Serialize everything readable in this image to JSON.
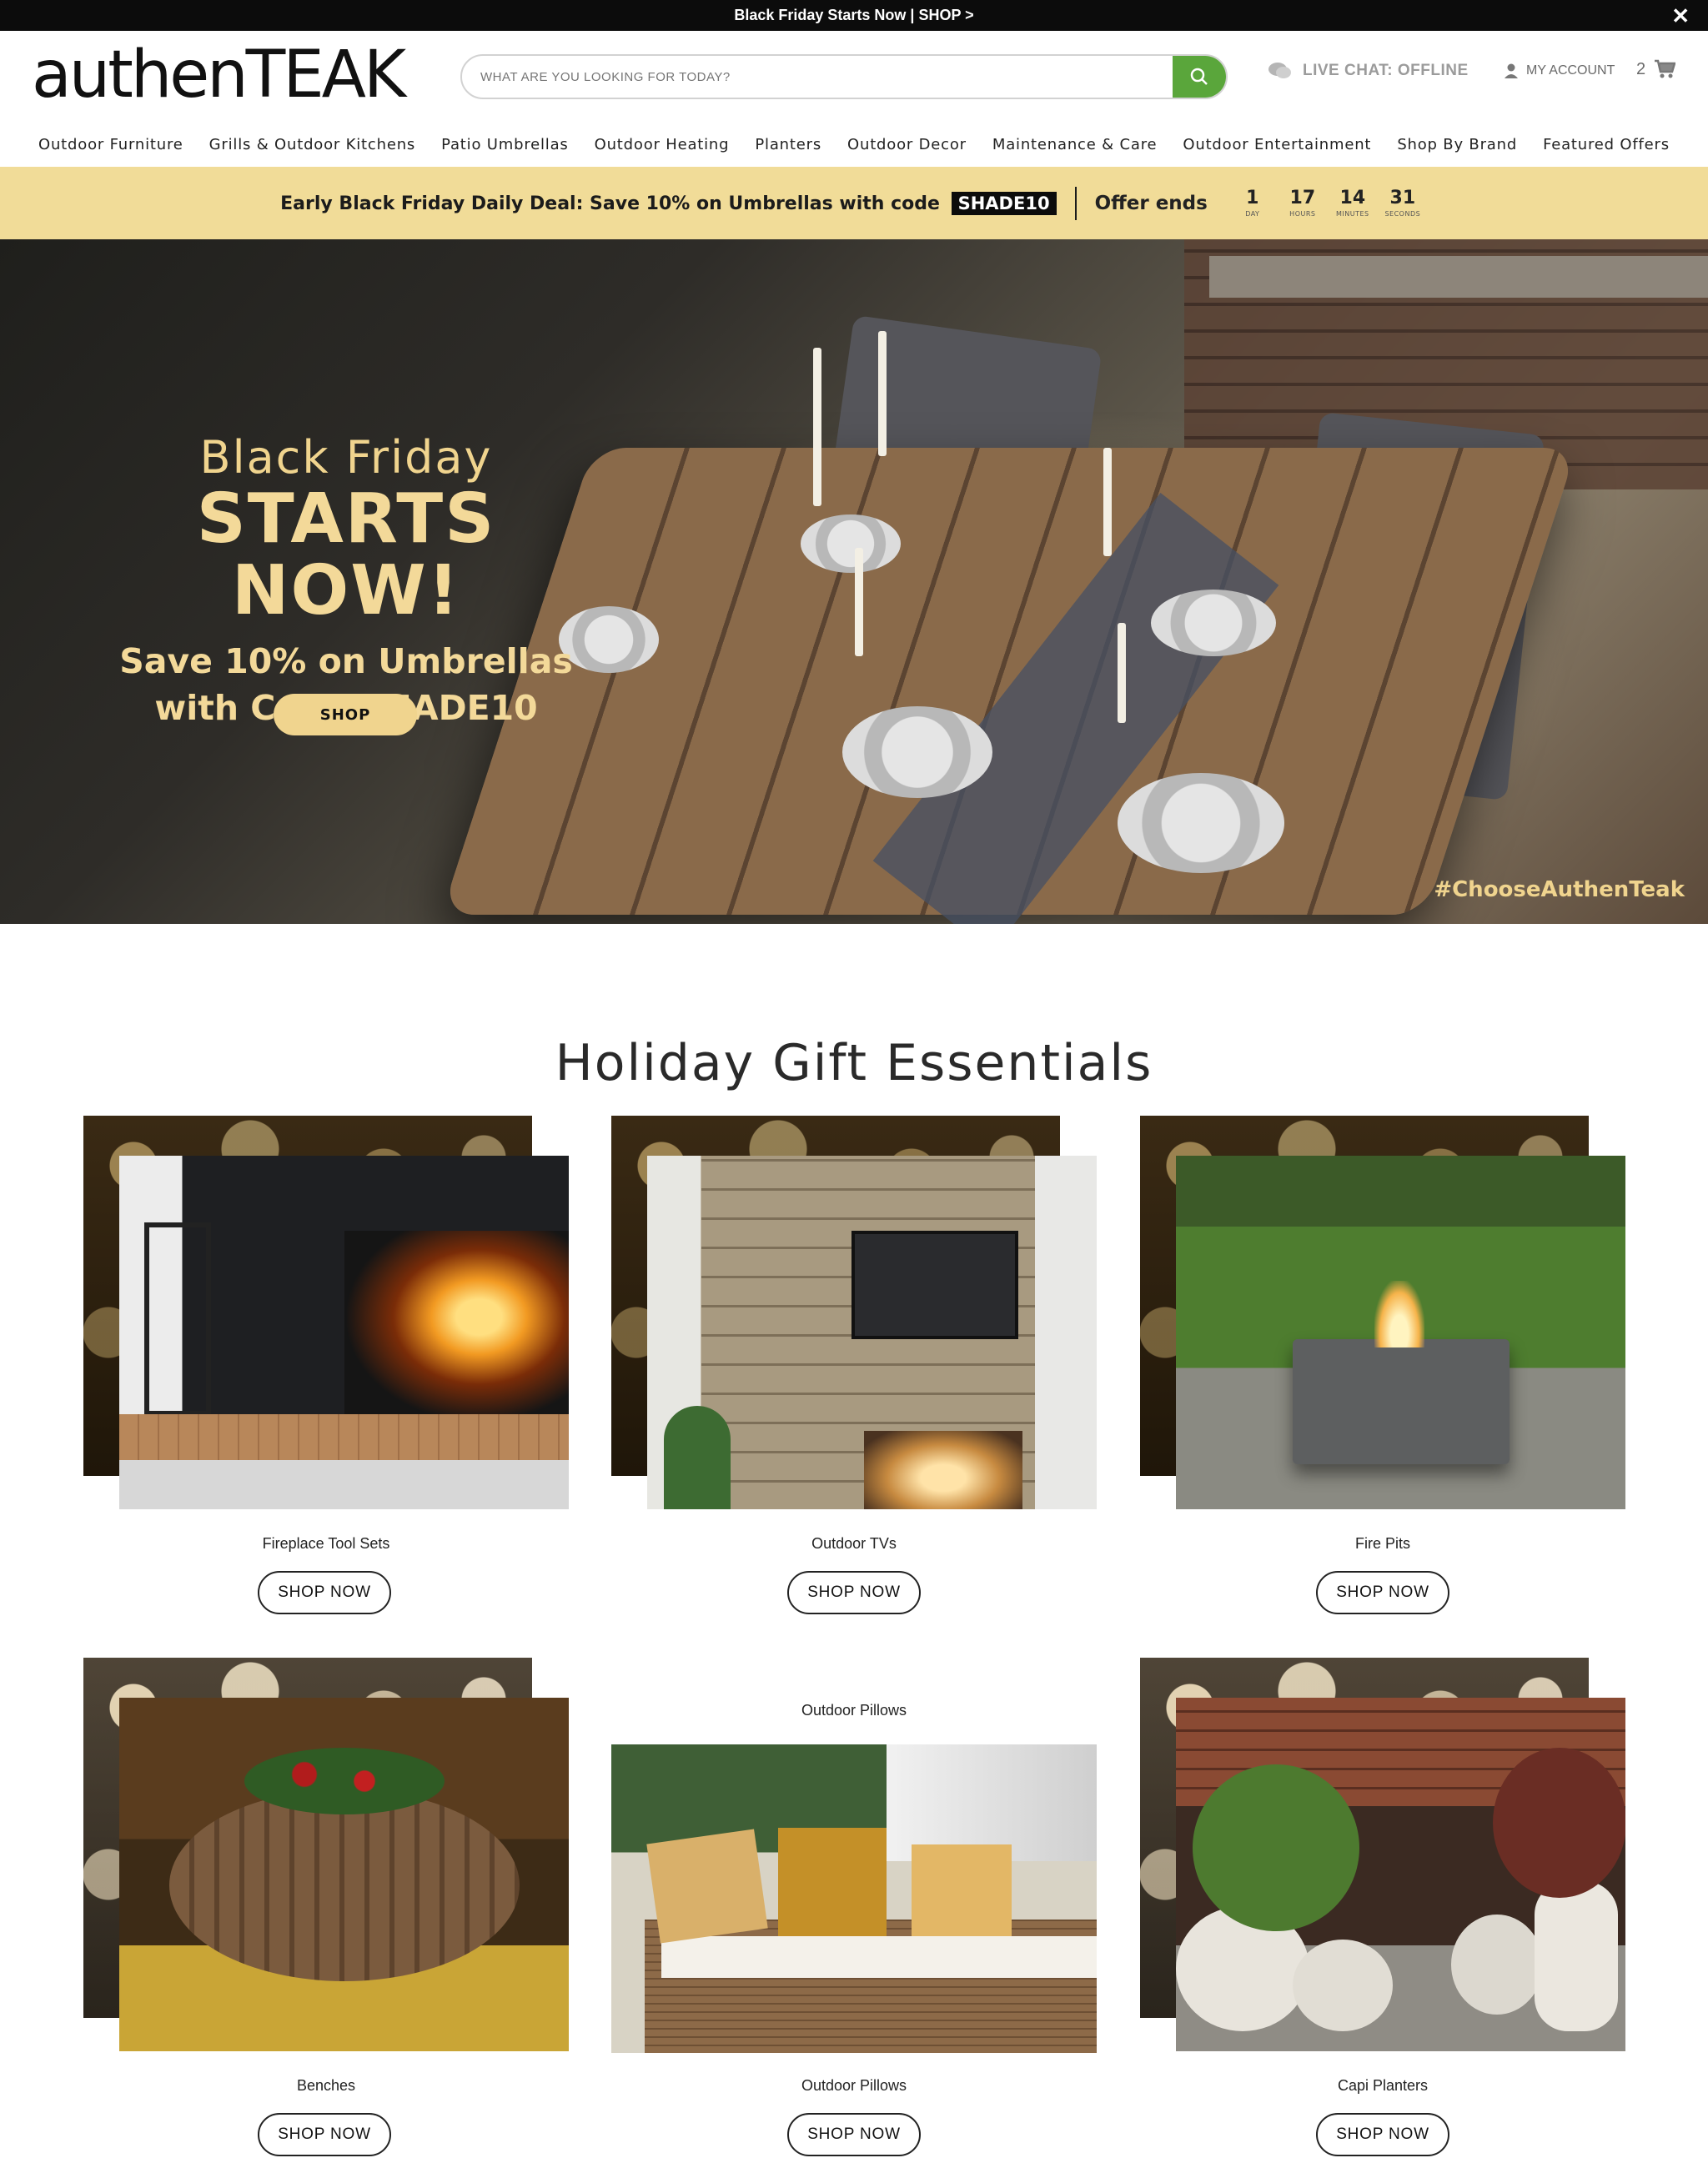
{
  "topbar": {
    "text": "Black Friday Starts Now | SHOP >",
    "close_icon": "close-icon"
  },
  "header": {
    "logo": "authenTEAK",
    "search_placeholder": "WHAT ARE YOU LOOKING FOR TODAY?",
    "live_chat": "LIVE CHAT: OFFLINE",
    "account": "MY ACCOUNT",
    "cart_count": "2"
  },
  "nav": {
    "items": [
      "Outdoor Furniture",
      "Grills & Outdoor Kitchens",
      "Patio Umbrellas",
      "Outdoor Heating",
      "Planters",
      "Outdoor Decor",
      "Maintenance & Care",
      "Outdoor Entertainment",
      "Shop By Brand",
      "Featured Offers"
    ]
  },
  "deal": {
    "text": "Early Black Friday Daily Deal: Save 10% on Umbrellas with code",
    "code": "SHADE10",
    "offer_ends": "Offer ends",
    "timer": [
      {
        "num": "1",
        "label": "DAY"
      },
      {
        "num": "17",
        "label": "HOURS"
      },
      {
        "num": "14",
        "label": "MINUTES"
      },
      {
        "num": "31",
        "label": "SECONDS"
      }
    ]
  },
  "hero": {
    "line1": "Black Friday",
    "line2": "STARTS NOW!",
    "line3": "Save 10% on Umbrellas",
    "line4": "with Code SHADE10",
    "button": "SHOP",
    "hashtag": "#ChooseAuthenTeak"
  },
  "section": {
    "title": "Holiday Gift Essentials",
    "cards": [
      {
        "label": "Fireplace Tool Sets",
        "button": "SHOP NOW"
      },
      {
        "label": "Outdoor TVs",
        "button": "SHOP NOW"
      },
      {
        "label": "Fire Pits",
        "button": "SHOP NOW"
      },
      {
        "label": "Benches",
        "button": "SHOP NOW"
      },
      {
        "label": "Outdoor Pillows",
        "button": "SHOP NOW"
      },
      {
        "label": "Capi Planters",
        "button": "SHOP NOW"
      }
    ],
    "overlay_label": "Outdoor Pillows"
  },
  "colors": {
    "accent_green": "#5aa63b",
    "deal_yellow": "#f1dc98",
    "hero_gold": "#f0d48e"
  }
}
